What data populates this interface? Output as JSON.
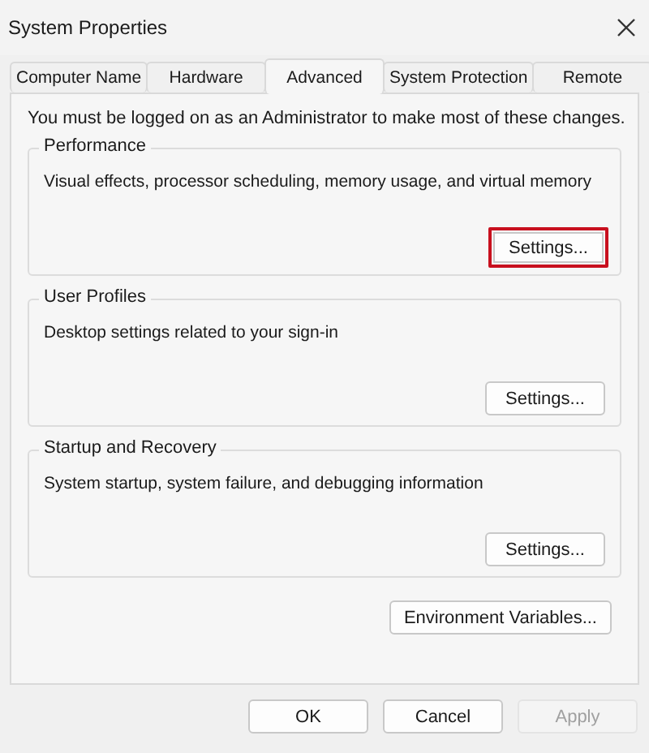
{
  "window": {
    "title": "System Properties"
  },
  "tabs": [
    {
      "label": "Computer Name",
      "selected": false
    },
    {
      "label": "Hardware",
      "selected": false
    },
    {
      "label": "Advanced",
      "selected": true
    },
    {
      "label": "System Protection",
      "selected": false
    },
    {
      "label": "Remote",
      "selected": false
    }
  ],
  "notice": "You must be logged on as an Administrator to make most of these changes.",
  "groups": [
    {
      "title": "Performance",
      "description": "Visual effects, processor scheduling, memory usage, and virtual memory",
      "button": {
        "label": "Settings...",
        "highlighted": true
      }
    },
    {
      "title": "User Profiles",
      "description": "Desktop settings related to your sign-in",
      "button": {
        "label": "Settings...",
        "highlighted": false
      }
    },
    {
      "title": "Startup and Recovery",
      "description": "System startup, system failure, and debugging information",
      "button": {
        "label": "Settings...",
        "highlighted": false
      }
    }
  ],
  "environment_button": {
    "label": "Environment Variables..."
  },
  "footer_buttons": [
    {
      "label": "OK",
      "disabled": false
    },
    {
      "label": "Cancel",
      "disabled": false
    },
    {
      "label": "Apply",
      "disabled": true
    }
  ]
}
